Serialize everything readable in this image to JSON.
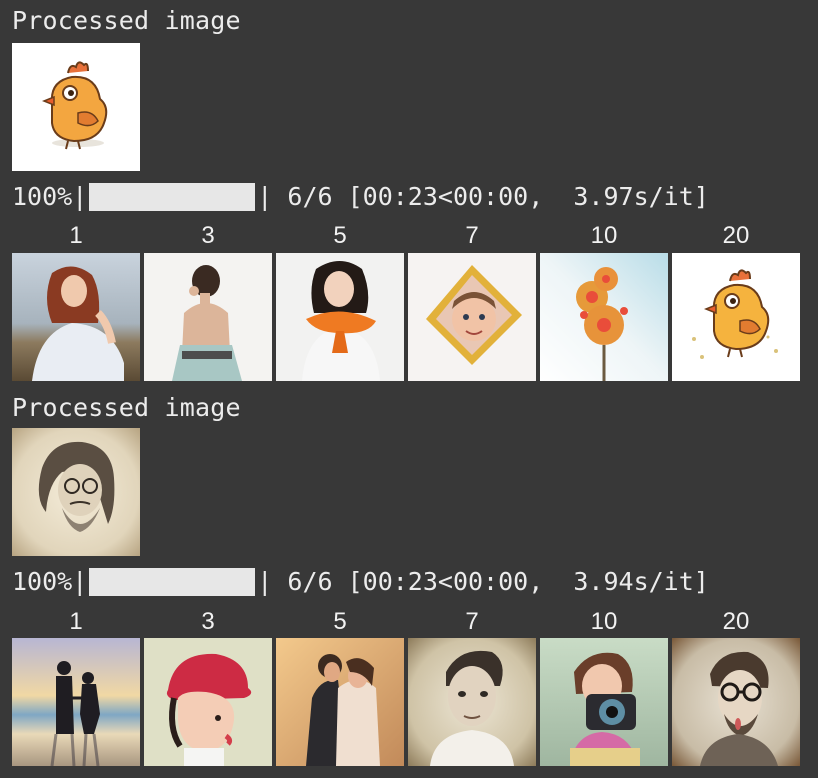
{
  "sections": [
    {
      "processed_label": "Processed image",
      "progress": {
        "percent_text": "100%",
        "fraction": 1.0,
        "stats": "6/6 [00:23<00:00,  3.97s/it]"
      },
      "steps": [
        "1",
        "3",
        "5",
        "7",
        "10",
        "20"
      ]
    },
    {
      "processed_label": "Processed image",
      "progress": {
        "percent_text": "100%",
        "fraction": 1.0,
        "stats": "6/6 [00:23<00:00,  3.94s/it]"
      },
      "steps": [
        "1",
        "3",
        "5",
        "7",
        "10",
        "20"
      ]
    }
  ],
  "colors": {
    "background": "#383838",
    "text": "#ececec",
    "progress_bar": "#e7e7e7"
  },
  "icons": {
    "section1_processed": "cartoon-chick-illustration",
    "section1_results": [
      "woman-beach-photo",
      "woman-dress-back-photo",
      "woman-orange-scarf-photo",
      "boy-in-frame-photo",
      "donut-balloon-photo",
      "cartoon-chick-photo"
    ],
    "section2_processed": "pencil-sketch-old-man",
    "section2_results": [
      "couple-beach-silhouette-photo",
      "girl-red-hat-photo",
      "couple-embrace-photo",
      "young-man-portrait-photo",
      "girl-camera-photo",
      "man-glasses-vintage-photo"
    ]
  }
}
